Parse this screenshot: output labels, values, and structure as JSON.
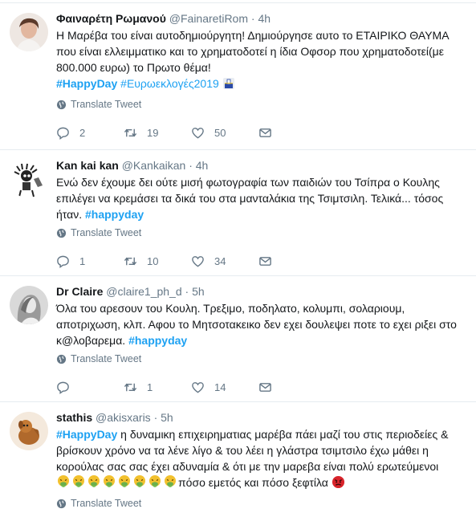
{
  "translate_label": "Translate Tweet",
  "tweets": [
    {
      "fullname": "Φαιναρέτη Ρωμανού",
      "username": "@FainaretiRom",
      "dot": "·",
      "time": "4h",
      "text_main": "Η Μαρέβα του είναι αυτοδημιούργητη! Δημιούργησε αυτο το ΕΤΑΙΡΙΚΟ ΘΑΥΜΑ που είναι ελλειμματικο και το χρηματοδοτεί η ίδια Οφσορ που χρηματοδοτεί(με 800.000 ευρω) το Πρωτο θέμα!",
      "hashtag1": "#HappyDay",
      "hashtag2": "#Ευρωεκλογές2019",
      "replies": "2",
      "retweets": "19",
      "likes": "50"
    },
    {
      "fullname": "Kan kai kan",
      "username": "@Kankaikan",
      "dot": "·",
      "time": "4h",
      "text_main": "Ενώ δεν έχουμε δει ούτε μισή φωτογραφία των παιδιών του Τσίπρα ο Κουλης επιλέγει να κρεμάσει τα δικά του στα μανταλάκια της Τσιμτσιλη. Τελικά... τόσος ήταν.",
      "hashtag1": "#happyday",
      "replies": "1",
      "retweets": "10",
      "likes": "34"
    },
    {
      "fullname": "Dr Claire",
      "username": "@claire1_ph_d",
      "dot": "·",
      "time": "5h",
      "text_main": "Όλα του αρεσουν του Κουλη. Τρεξιμο, ποδηλατο, κολυμπι, σολαριουμ, αποτριχωση, κλπ. Αφου το Μητσοτακεικο δεν εχει δουλεψει ποτε το εχει ριξει στο κ@λοβαρεμα.",
      "hashtag1": "#happyday",
      "replies": "",
      "retweets": "1",
      "likes": "14"
    },
    {
      "fullname": "stathis",
      "username": "@akisxaris",
      "dot": "·",
      "time": "5h",
      "hashtag1": "#HappyDay",
      "text_main": "η δυναμικη επιχειρηματιας μαρέβα πάει μαζί του στις περιοδείες & βρίσκουν χρόνο να τα λένε λίγο & του λέει η γλάστρα τσιμτσιλο έχω μάθει η κορούλας σας σας έχει αδυναμία & ότι με την μαρεβα είναι πολύ ερωτεύμενοι",
      "text_tail": "πόσο εμετός και πόσο ξεφτίλα"
    }
  ],
  "icons": {
    "reply": "reply-icon",
    "retweet": "retweet-icon",
    "like": "heart-icon",
    "dm": "envelope-icon",
    "globe": "globe-icon",
    "vomit": "vomiting-face-icon",
    "angry": "angry-face-icon",
    "ballot": "ballot-box-icon"
  },
  "colors": {
    "link": "#1da1f2",
    "muted": "#657786",
    "text": "#14171a",
    "divider": "#e6ecf0"
  }
}
